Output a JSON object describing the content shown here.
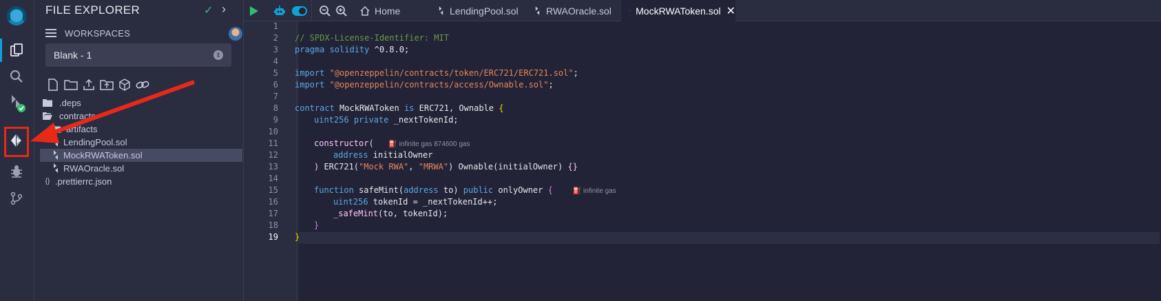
{
  "colors": {
    "accent": "#0fa2d8",
    "success": "#2fbf71",
    "annotation": "#e8291a",
    "background": "#222336",
    "panel": "#2a2c3f"
  },
  "sidebar_icons": [
    {
      "name": "remix-logo-icon"
    },
    {
      "name": "file-explorer-icon"
    },
    {
      "name": "search-icon"
    },
    {
      "name": "solidity-compiler-icon"
    },
    {
      "name": "deploy-run-icon"
    },
    {
      "name": "debugger-icon"
    },
    {
      "name": "git-icon"
    }
  ],
  "explorer": {
    "title": "FILE EXPLORER",
    "workspaces_label": "WORKSPACES",
    "workspace_selected": "Blank - 1",
    "tree": [
      {
        "label": ".deps",
        "type": "folder"
      },
      {
        "label": "contracts",
        "type": "folder-open"
      },
      {
        "label": "artifacts",
        "type": "folder"
      },
      {
        "label": "LendingPool.sol",
        "type": "file"
      },
      {
        "label": "MockRWAToken.sol",
        "type": "file",
        "selected": true
      },
      {
        "label": "RWAOracle.sol",
        "type": "file"
      },
      {
        "label": ".prettierrc.json",
        "type": "json"
      }
    ]
  },
  "tabs": [
    {
      "label": "Home"
    },
    {
      "label": "LendingPool.sol"
    },
    {
      "label": "RWAOracle.sol"
    },
    {
      "label": "MockRWAToken.sol",
      "active": true
    }
  ],
  "editor": {
    "line_numbers": [
      "1",
      "2",
      "3",
      "4",
      "5",
      "6",
      "7",
      "8",
      "9",
      "10",
      "11",
      "12",
      "13",
      "14",
      "15",
      "16",
      "17",
      "18",
      "19"
    ],
    "active_line": "19",
    "lines": {
      "l2": "// SPDX-License-Identifier: MIT",
      "l3_kw": "pragma solidity",
      "l3_rest": " ^0.8.0;",
      "l5_kw": "import",
      "l5_str": "\"@openzeppelin/contracts/token/ERC721/ERC721.sol\"",
      "l5_end": ";",
      "l6_kw": "import",
      "l6_str": "\"@openzeppelin/contracts/access/Ownable.sol\"",
      "l6_end": ";",
      "l8_kw": "contract",
      "l8_name": " MockRWAToken ",
      "l8_is": "is",
      "l8_rest": " ERC721, Ownable ",
      "l8_brace": "{",
      "l9_type": "uint256",
      "l9_mod": "private",
      "l9_rest": " _nextTokenId;",
      "l11_kw": "constructor",
      "l11_paren": "(",
      "l11_hint": "infinite gas 874600 gas",
      "l12_type": "address",
      "l12_rest": " initialOwner",
      "l13_paren": ")",
      "l13_a": " ERC721(",
      "l13_s1": "\"Mock RWA\"",
      "l13_b": ", ",
      "l13_s2": "\"MRWA\"",
      "l13_c": ") Ownable(initialOwner) ",
      "l13_brace": "{}",
      "l15_kw": "function",
      "l15_name": " safeMint",
      "l15_a": "(",
      "l15_type": "address",
      "l15_b": " to) ",
      "l15_mod": "public",
      "l15_c": " onlyOwner ",
      "l15_brace": "{",
      "l15_hint": "infinite gas",
      "l16_type": "uint256",
      "l16_rest": " tokenId = _nextTokenId++;",
      "l17_fn": "_safeMint",
      "l17_rest": "(to, tokenId);",
      "l18": "}",
      "l19": "}"
    }
  }
}
